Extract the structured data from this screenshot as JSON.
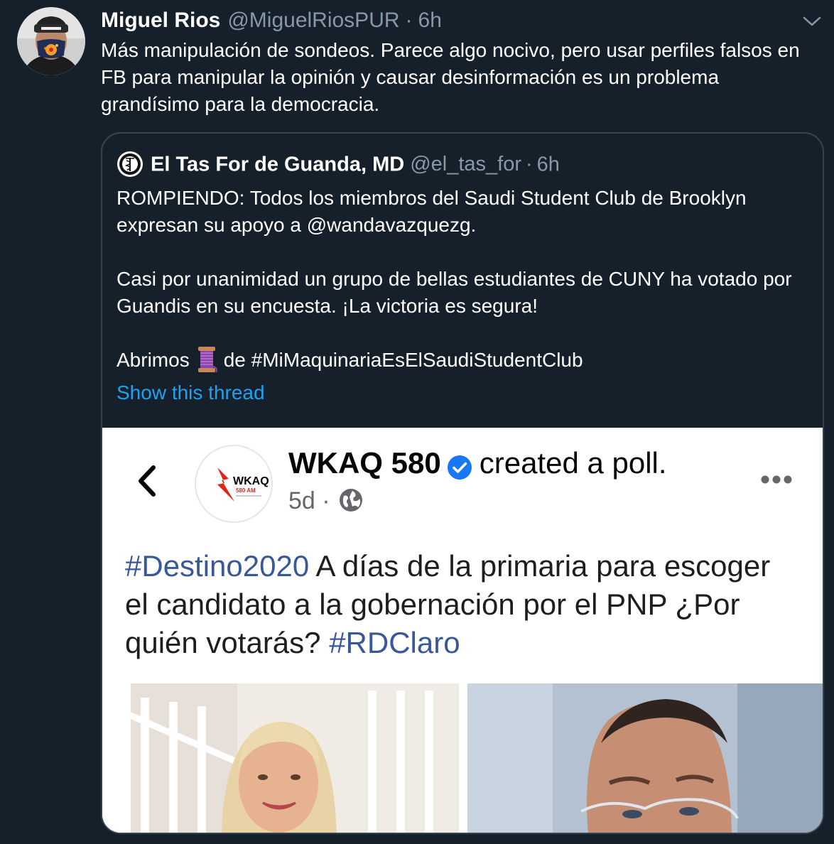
{
  "tweet": {
    "author_name": "Miguel Rios",
    "author_handle": "@MiguelRiosPUR",
    "separator": "·",
    "time": "6h",
    "text": "Más manipulación de sondeos. Parece algo nocivo, pero usar perfiles falsos en FB para manipular la opinión y causar desinformación es un problema grandísimo para la democracia."
  },
  "quoted": {
    "author_name": "El Tas For de Guanda, MD",
    "author_handle": "@el_tas_for",
    "separator": "·",
    "time": "6h",
    "paragraph1": "ROMPIENDO:  Todos los miembros del Saudi Student Club de Brooklyn expresan su apoyo a @wandavazquezg.",
    "paragraph2": "Casi por unanimidad un grupo de bellas estudiantes de CUNY ha votado por Guandis en su encuesta.  ¡La victoria es segura!",
    "paragraph3_before": "Abrimos",
    "paragraph3_after": "de #MiMaquinariaEsElSaudiStudentClub",
    "show_thread": "Show this thread"
  },
  "media": {
    "page_name": "WKAQ 580",
    "action": "created a poll.",
    "age": "5d",
    "meta_separator": "·",
    "logo_text": "WKAQ",
    "logo_subtext": "580 AM",
    "post_hashtag1": "#Destino2020",
    "post_text": " A días de la primaria para escoger el candidato a la gobernación por el PNP ¿Por quién votarás? ",
    "post_hashtag2": "#RDClaro"
  },
  "colors": {
    "background": "#15202b",
    "border": "#38444d",
    "secondary_text": "#8899a6",
    "link": "#1da1f2",
    "facebook_link": "#385898",
    "verified_blue": "#1877f2",
    "wkaq_red": "#e2231a"
  },
  "icons": {
    "caret": "chevron-down-icon",
    "thread": "spool-of-thread-emoji",
    "back": "chevron-left-icon",
    "verified": "verified-badge-icon",
    "audience": "globe-icon",
    "more": "more-dots-icon"
  }
}
